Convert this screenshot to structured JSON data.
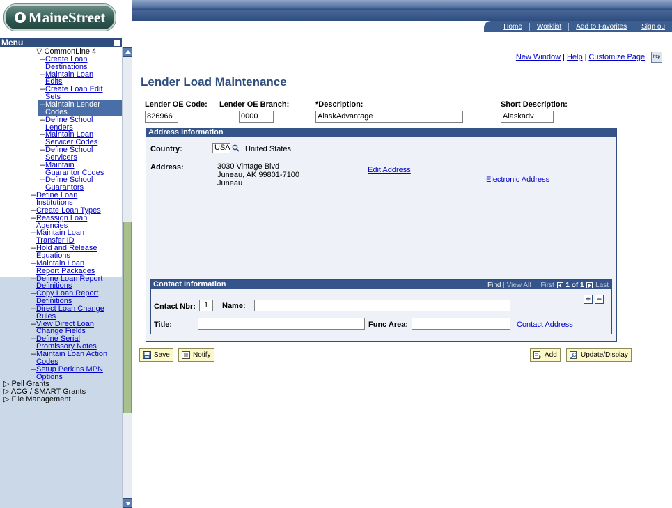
{
  "header": {
    "logo_text": "MaineStreet",
    "links": [
      "Home",
      "Worklist",
      "Add to Favorites",
      "Sign ou"
    ]
  },
  "menu": {
    "title": "Menu",
    "items": [
      {
        "label": "CommonLine 4",
        "level": "folder-open"
      },
      {
        "label": "Create Loan"
      },
      {
        "label": "Destinations"
      },
      {
        "label": "Maintain Loan"
      },
      {
        "label": "Edits"
      },
      {
        "label": "Create Loan Edit"
      },
      {
        "label": "Sets"
      },
      {
        "label": "Maintain Lender"
      },
      {
        "label": "Codes"
      },
      {
        "label": "Define School"
      },
      {
        "label": "Lenders"
      },
      {
        "label": "Maintain Loan"
      },
      {
        "label": "Servicer Codes"
      },
      {
        "label": "Define School"
      },
      {
        "label": "Servicers"
      },
      {
        "label": "Maintain"
      },
      {
        "label": "Guarantor Codes"
      },
      {
        "label": "Define School"
      },
      {
        "label": "Guarantors"
      },
      {
        "label": "Define Loan"
      },
      {
        "label": "Institutions"
      },
      {
        "label": "Create Loan Types"
      },
      {
        "label": "Reassign Loan"
      },
      {
        "label": "Agencies"
      },
      {
        "label": "Maintain Loan"
      },
      {
        "label": "Transfer ID"
      },
      {
        "label": "Hold and Release"
      },
      {
        "label": "Equations"
      },
      {
        "label": "Maintain Loan"
      },
      {
        "label": "Report Packages"
      },
      {
        "label": "Define Loan Report"
      },
      {
        "label": "Definitions"
      },
      {
        "label": "Copy Loan Report"
      },
      {
        "label": "Definitions"
      },
      {
        "label": "Direct Loan Change"
      },
      {
        "label": "Rules"
      },
      {
        "label": "View Direct Loan"
      },
      {
        "label": "Change Fields"
      },
      {
        "label": "Define Serial"
      },
      {
        "label": "Promissory Notes"
      },
      {
        "label": "Maintain Loan Action"
      },
      {
        "label": "Codes"
      },
      {
        "label": "Setup Perkins MPN"
      },
      {
        "label": "Options"
      },
      {
        "label": "Pell Grants"
      },
      {
        "label": "ACG / SMART Grants"
      },
      {
        "label": "File Management"
      }
    ]
  },
  "utility": {
    "new_window": "New Window",
    "help": "Help",
    "customize": "Customize Page",
    "sep": "|",
    "http_icon": "http"
  },
  "page": {
    "title": "Lender Load Maintenance"
  },
  "form": {
    "lender_oe_code_label": "Lender OE Code:",
    "lender_oe_code": "826966",
    "lender_oe_branch_label": "Lender OE Branch:",
    "lender_oe_branch": "0000",
    "description_label": "*Description:",
    "description": "AlaskAdvantage",
    "short_description_label": "Short Description:",
    "short_description": "Alaskadv"
  },
  "address": {
    "header": "Address Information",
    "country_label": "Country:",
    "country_code": "USA",
    "country_name": "United States",
    "address_label": "Address:",
    "line1": "3030 Vintage Blvd",
    "line2": "Juneau, AK 99801-7100",
    "line3": "Juneau",
    "edit_address": "Edit Address",
    "electronic_address": "Electronic Address"
  },
  "contact": {
    "header": "Contact Information",
    "find": "Find",
    "view_all": "View All",
    "first": "First",
    "page_info": "1 of 1",
    "last": "Last",
    "cntact_nbr_label": "Cntact Nbr:",
    "cntact_nbr": "1",
    "name_label": "Name:",
    "name": "",
    "title_label": "Title:",
    "title": "",
    "func_area_label": "Func Area:",
    "func_area": "",
    "contact_address": "Contact Address"
  },
  "buttons": {
    "save": "Save",
    "notify": "Notify",
    "add": "Add",
    "update_display": "Update/Display"
  },
  "colors": {
    "brand_navy": "#2f4e7d",
    "menu_selected": "#4a6ea8",
    "button_bg": "#fdf8c7",
    "logo_green": "#2e5751"
  }
}
